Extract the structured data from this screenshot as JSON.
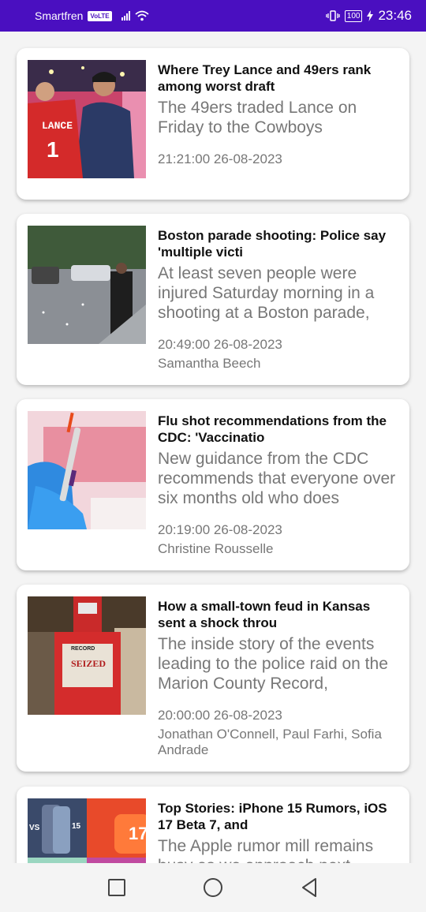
{
  "status_bar": {
    "carrier": "Smartfren",
    "volte_badge": "VoLTE",
    "battery": "100",
    "time": "23:46"
  },
  "articles": [
    {
      "title": "Where Trey Lance and 49ers rank among worst draft",
      "description": "The 49ers traded Lance on Friday to the Cowboys",
      "date": "21:21:00 26-08-2023",
      "author": "",
      "jersey_name": "LANCE",
      "jersey_number": "1"
    },
    {
      "title": "Boston parade shooting: Police say 'multiple victi",
      "description": "At least seven people were injured Saturday morning in a shooting at a Boston parade,",
      "date": "20:49:00 26-08-2023",
      "author": "Samantha Beech"
    },
    {
      "title": "Flu shot recommendations from the CDC: 'Vaccinatio",
      "description": "New guidance from the CDC recommends that everyone over six months old who does",
      "date": "20:19:00 26-08-2023",
      "author": "Christine Rousselle"
    },
    {
      "title": "How a small-town feud in Kansas sent a shock throu",
      "description": "The inside story of the events leading to the police raid on the Marion County Record,",
      "date": "20:00:00 26-08-2023",
      "author": "Jonathan O'Connell, Paul Farhi, Sofia Andrade",
      "box_label": "RECORD",
      "sign_label": "SEIZED"
    },
    {
      "title": "Top Stories: iPhone 15 Rumors, iOS 17 Beta 7, and",
      "description": "The Apple rumor mill remains busy as we approach next month's",
      "date": "",
      "author": "",
      "thumb_vs": "VS",
      "thumb_15": "15",
      "thumb_17": "17"
    }
  ]
}
